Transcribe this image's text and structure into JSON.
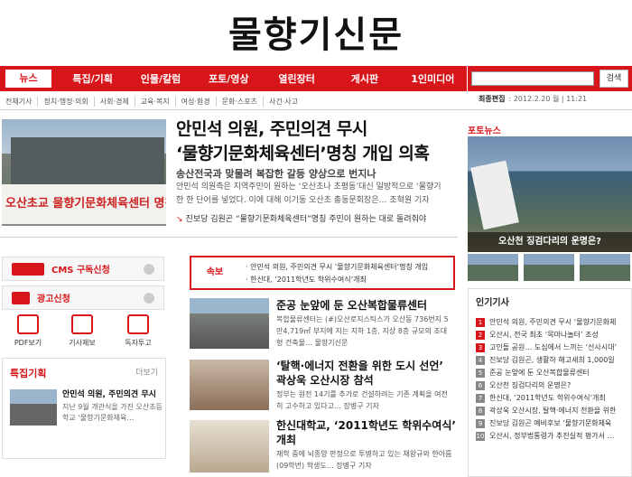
{
  "site": {
    "logo": "물향기신문"
  },
  "nav": {
    "tabs": [
      "뉴스",
      "특집/기획",
      "인물/칼럼",
      "포토/영상",
      "열린장터",
      "게시판",
      "1인미디어"
    ]
  },
  "search": {
    "placeholder": "",
    "button": "검색"
  },
  "subnav": [
    "전체기사",
    "정치·행정·의회",
    "사회·경제",
    "교육·복지",
    "여성·환경",
    "문화·스포츠",
    "사건·사고"
  ],
  "edit_info": {
    "label": "최종편집",
    "date": ": 2012.2.20 월 | 11:21"
  },
  "headline": {
    "photo_banner": "오산초교 물향기문화체육센터 명칭 웬말이냐?",
    "title_line1": "안민석 의원, 주민의견 무시",
    "title_line2": "‘물향기문화체육센터’명칭 개입 의혹",
    "subtitle": "송산전국과 맞물려 복잡한 갈등 양상으로 번지나",
    "body": "안민석 의원측은 지역주민이 원하는 ‘오산초나 초평동’대신 일방적으로 ‘물향기한 한 단어를 넣었다. 이에 대해 이기동 오산초 총동문회장은… 조혁원 기자",
    "related": "진보당 김원곤 “물향기문화체육센터”명칭 주민이 원하는 대로 돌려줘야"
  },
  "services": {
    "cms": "CMS 구독신청",
    "ad": "광고신청"
  },
  "quick": [
    "PDF보기",
    "기사제보",
    "독자투고"
  ],
  "special": {
    "title": "특집기획",
    "more": "더보기",
    "item_title": "안민석 의원, 주민의견 무시",
    "item_body": "지난 9월 개관식을 가진 오산초등학교 ‘물향기문화체육…"
  },
  "breaking": {
    "label": "속보",
    "items": [
      "· 안민석 의원, 주민의견 무시 ‘물향기문화체육센터’명칭 개입",
      "· 한신대, ‘2011학년도 학위수여식’개최"
    ]
  },
  "news": [
    {
      "title": "준공 눈앞에 둔 오산복합물류센터",
      "body": "복합물류센터는 (#)오산로지스틱스가 오산동 736번지 5만4,719㎡ 부지에 지는 지하 1층, 지상 8층 규모의 초대형 건축물… 물향기신문"
    },
    {
      "title": "‘탈핵·에너지 전환을 위한 도시 선언’ 곽상욱 오산시장 참석",
      "body": "정부는 원전 14기를 추가로 건설하려는 기존 계획을 여전히 고수하고 있다고… 장병구 기자"
    },
    {
      "title": "한신대학교, ‘2011학년도 학위수여식’ 개최",
      "body": "재학 중에 뇌종양 판정으로 투병하고 있는 채왕규와 한아름(09학번) 학생도… 장병구 기자"
    }
  ],
  "side": {
    "photo_title_prefix": "포토",
    "photo_title_suffix": "뉴스",
    "photo_caption": "오산천 징검다리의 운명은?"
  },
  "ranking": {
    "title": "인기기사",
    "items": [
      "안민석 의원, 주민의견 무시 ‘물향기문화체",
      "오산시, 전국 최초 ‘목마나놀터’ 조성",
      "고인돌 공원… 도심에서 느끼는 ‘선사시대’",
      "진보당 김원곤, 생활하 해고새희 1,000일",
      "준공 눈앞에 둔 오산복합물류센터",
      "오산천 징검다리의 운명은?",
      "한신대, ‘2011학년도 학위수여식’개최",
      "곽상욱 오산시장, 탈핵·에너지 전환을 위한",
      "진보당 김원곤 예비후보 ‘물향기문화체육",
      "오산시, 정부법통령가 추진실적 평가서 …"
    ]
  },
  "colors": {
    "accent": "#d8151b"
  }
}
